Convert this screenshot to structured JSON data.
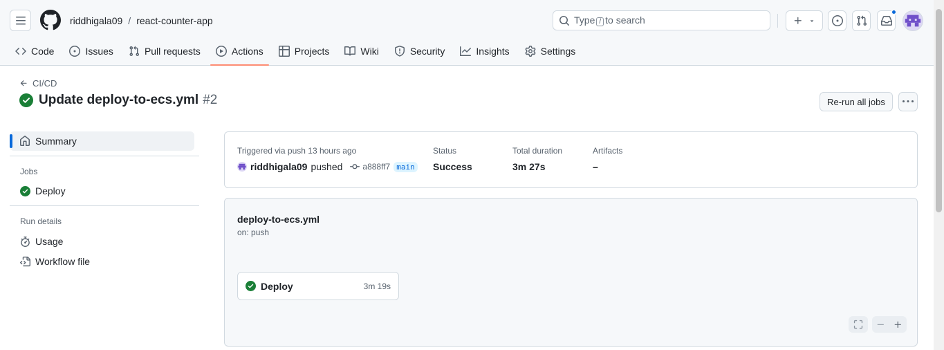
{
  "header": {
    "owner": "riddhigala09",
    "separator": "/",
    "repo": "react-counter-app",
    "search_placeholder_pre": "Type",
    "search_key": "/",
    "search_placeholder_post": "to search"
  },
  "repo_nav": [
    {
      "label": "Code",
      "icon": "code-icon"
    },
    {
      "label": "Issues",
      "icon": "issue-opened-icon"
    },
    {
      "label": "Pull requests",
      "icon": "git-pull-request-icon"
    },
    {
      "label": "Actions",
      "icon": "play-icon",
      "active": true
    },
    {
      "label": "Projects",
      "icon": "table-icon"
    },
    {
      "label": "Wiki",
      "icon": "book-icon"
    },
    {
      "label": "Security",
      "icon": "shield-icon"
    },
    {
      "label": "Insights",
      "icon": "graph-icon"
    },
    {
      "label": "Settings",
      "icon": "gear-icon"
    }
  ],
  "run": {
    "back_label": "CI/CD",
    "title": "Update deploy-to-ecs.yml",
    "number": "#2",
    "rerun_label": "Re-run all jobs"
  },
  "sidebar": {
    "summary": "Summary",
    "jobs_heading": "Jobs",
    "jobs": [
      "Deploy"
    ],
    "run_details_heading": "Run details",
    "usage": "Usage",
    "workflow_file": "Workflow file"
  },
  "summary": {
    "trigger_caption": "Triggered via push 13 hours ago",
    "actor": "riddhigala09",
    "action": "pushed",
    "commit": "a888ff7",
    "branch": "main",
    "status_caption": "Status",
    "status_value": "Success",
    "duration_caption": "Total duration",
    "duration_value": "3m 27s",
    "artifacts_caption": "Artifacts",
    "artifacts_value": "–"
  },
  "workflow": {
    "file": "deploy-to-ecs.yml",
    "on": "on: push",
    "job_name": "Deploy",
    "job_duration": "3m 19s"
  },
  "colors": {
    "success": "#1a7f37",
    "accent": "#0969da",
    "active_tab_underline": "#fd8c73"
  }
}
